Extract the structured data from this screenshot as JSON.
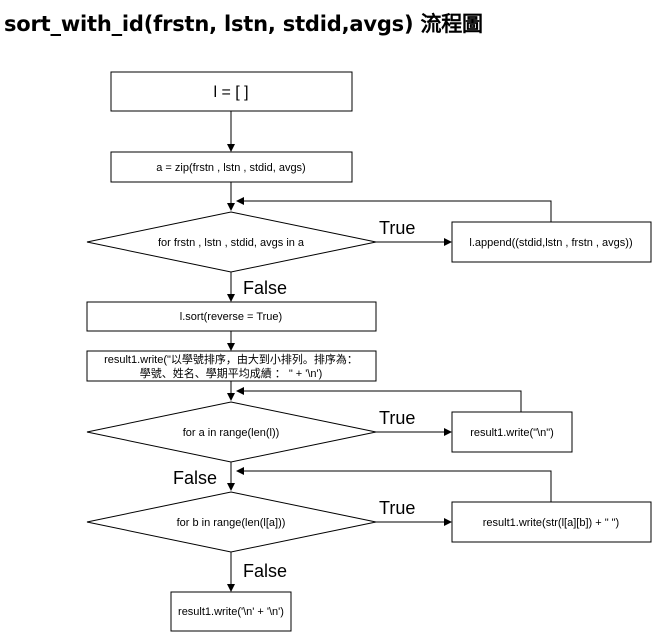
{
  "title": "sort_with_id(frstn, lstn, stdid,avgs) 流程圖",
  "nodes": {
    "init_list": "l = [ ]",
    "zip_assign": "a = zip(frstn , lstn , stdid, avgs)",
    "for_loop_a": "for frstn , lstn , stdid, avgs in a",
    "append": "l.append((stdid,lstn , frstn , avgs))",
    "sort": "l.sort(reverse = True)",
    "write_header_line1": "result1.write(\"以學號排序，由大到小排列。排序為：",
    "write_header_line2": "學號、姓名、學期平均成績 ： \" + '\\n')",
    "for_range_l": "for a in range(len(l))",
    "write_newline": "result1.write(\"\\n\")",
    "for_range_la": "for b in range(len(l[a]))",
    "write_item": "result1.write(str(l[a][b]) + \" \")",
    "write_end": "result1.write('\\n' + '\\n')"
  },
  "edge_labels": {
    "true1": "True",
    "false1": "False",
    "true2": "True",
    "false2": "False",
    "true3": "True",
    "false3": "False"
  }
}
